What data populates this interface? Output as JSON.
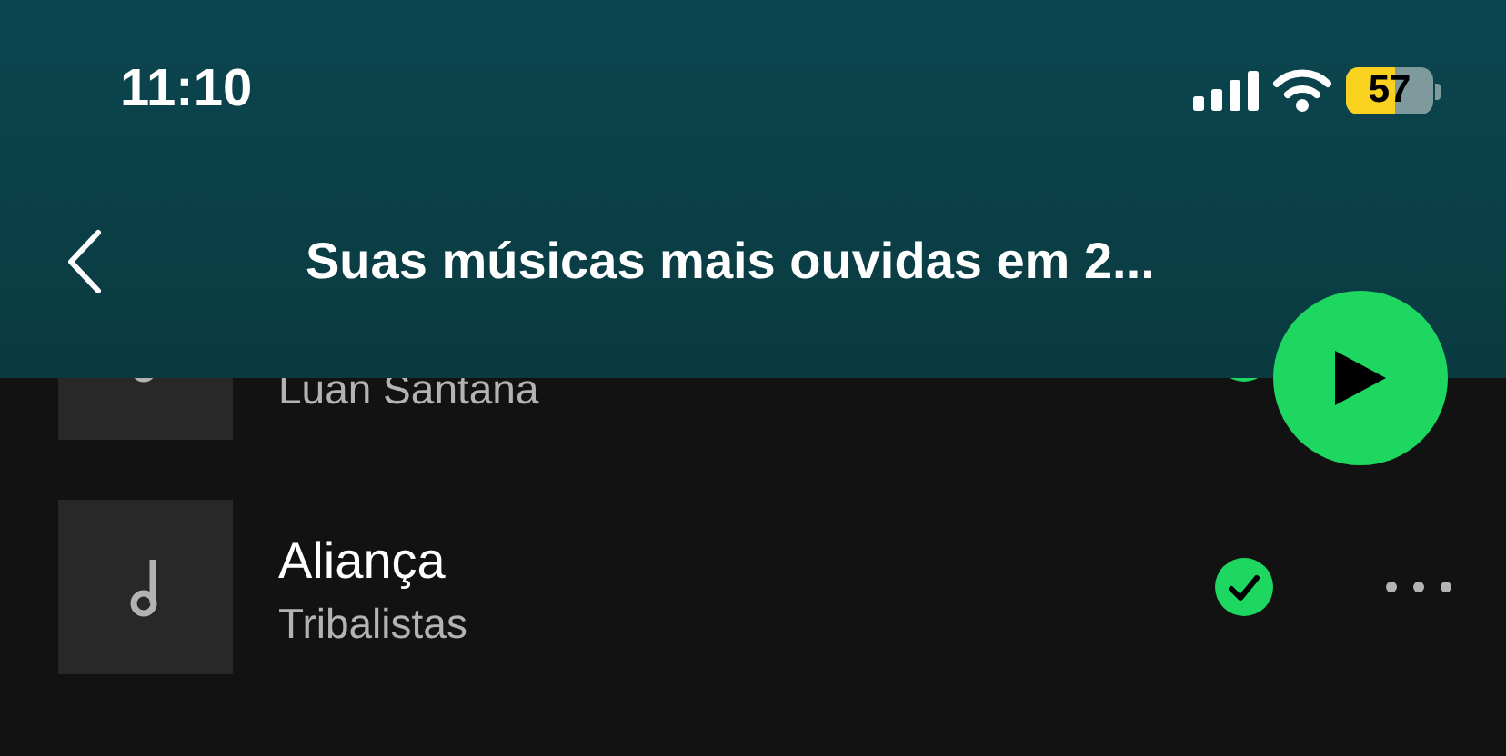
{
  "status_bar": {
    "time": "11:10",
    "battery": "57"
  },
  "header": {
    "title": "Suas músicas mais ouvidas em 2..."
  },
  "tracks": [
    {
      "artist": "Luan Santana",
      "downloaded": true
    },
    {
      "title": "Aliança",
      "artist": "Tribalistas",
      "downloaded": true,
      "more_options": true
    }
  ]
}
